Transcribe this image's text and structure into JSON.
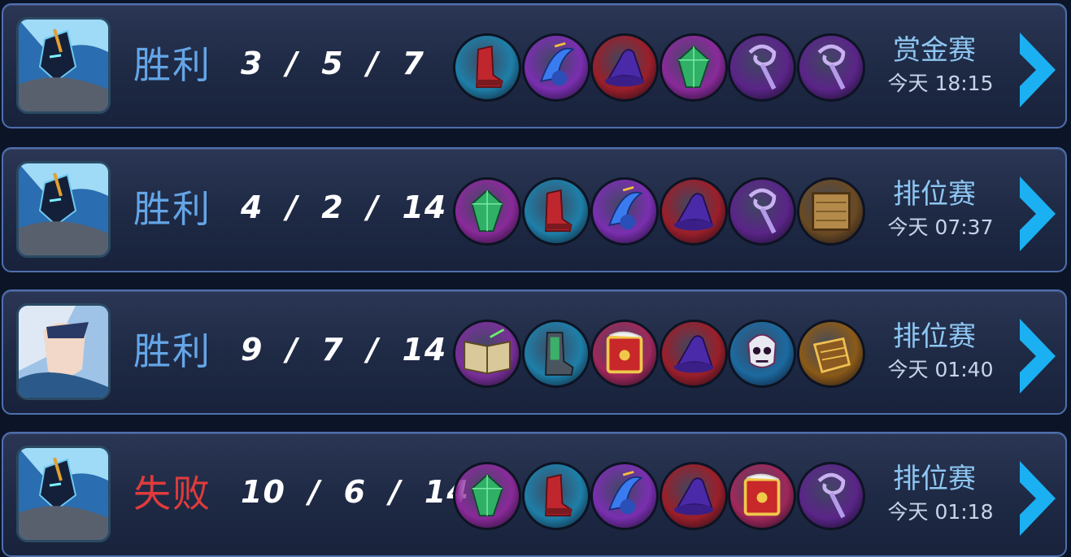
{
  "colors": {
    "win": "#64a5e6",
    "lose": "#e03b3b",
    "accent": "#1bb0f2",
    "panel": "#1e2944",
    "border": "#4e6fae"
  },
  "matches": [
    {
      "hero_icon": "blue-armored-knight-hero-portrait",
      "result": "胜利",
      "result_type": "win",
      "kda": "3  /  5  /  7",
      "items": [
        {
          "icon": "red-boots-icon",
          "bg": "#1e7fa8"
        },
        {
          "icon": "blue-feather-orb-icon",
          "bg": "#7a2fb0"
        },
        {
          "icon": "purple-wizard-hat-icon",
          "bg": "#9a1f2a"
        },
        {
          "icon": "green-gem-icon",
          "bg": "#8a2a9a"
        },
        {
          "icon": "purple-scepter-icon",
          "bg": "#5a2588"
        },
        {
          "icon": "purple-scepter-icon",
          "bg": "#5a2588"
        }
      ],
      "mode": "赏金赛",
      "time": "今天 18:15"
    },
    {
      "hero_icon": "blue-armored-knight-hero-portrait",
      "result": "胜利",
      "result_type": "win",
      "kda": "4  /  2  /  14",
      "items": [
        {
          "icon": "green-gem-icon",
          "bg": "#8a2a9a"
        },
        {
          "icon": "red-boots-icon",
          "bg": "#1e7fa8"
        },
        {
          "icon": "blue-feather-orb-icon",
          "bg": "#7a2fb0"
        },
        {
          "icon": "purple-wizard-hat-icon",
          "bg": "#9a1f2a"
        },
        {
          "icon": "purple-scepter-icon",
          "bg": "#5a2588"
        },
        {
          "icon": "wooden-book-icon",
          "bg": "#6a4a22"
        }
      ],
      "mode": "排位赛",
      "time": "今天 07:37"
    },
    {
      "hero_icon": "white-haired-mage-hero-portrait",
      "result": "胜利",
      "result_type": "win",
      "kda": "9  /  7  /  14",
      "items": [
        {
          "icon": "open-spellbook-icon",
          "bg": "#7a2f9a"
        },
        {
          "icon": "green-boots-icon",
          "bg": "#1e7fa8"
        },
        {
          "icon": "golden-tome-icon",
          "bg": "#a0285a"
        },
        {
          "icon": "purple-wizard-hat-icon",
          "bg": "#9a1f2a"
        },
        {
          "icon": "skull-mask-icon",
          "bg": "#1c6aa0"
        },
        {
          "icon": "golden-gauntlet-icon",
          "bg": "#8a5a18"
        }
      ],
      "mode": "排位赛",
      "time": "今天 01:40"
    },
    {
      "hero_icon": "blue-armored-knight-hero-portrait",
      "result": "失败",
      "result_type": "lose",
      "kda": "10  /  6  /  14",
      "items": [
        {
          "icon": "green-gem-icon",
          "bg": "#8a2a9a"
        },
        {
          "icon": "red-boots-icon",
          "bg": "#1e7fa8"
        },
        {
          "icon": "blue-feather-orb-icon",
          "bg": "#7a2fb0"
        },
        {
          "icon": "purple-wizard-hat-icon",
          "bg": "#9a1f2a"
        },
        {
          "icon": "golden-tome-icon",
          "bg": "#a0285a"
        },
        {
          "icon": "purple-scepter-icon",
          "bg": "#5a2588"
        }
      ],
      "mode": "排位赛",
      "time": "今天 01:18"
    }
  ]
}
